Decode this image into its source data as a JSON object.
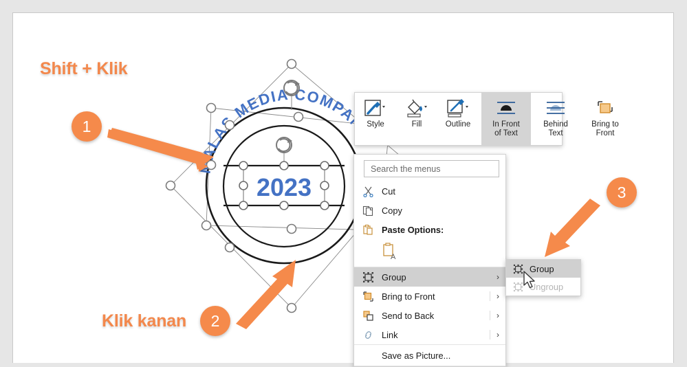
{
  "app": {
    "canvas_background": "#e6e6e6",
    "page_background": "#ffffff",
    "accent_orange": "#F58A4B",
    "wordart_blue": "#4472C4"
  },
  "artwork": {
    "wordart_curved_text": "MALAS MEDIA COMPANY",
    "year_text": "2023"
  },
  "annotations": {
    "labels": [
      {
        "id": "shift-klik",
        "text": "Shift + Klik",
        "color": "#F3884C"
      },
      {
        "id": "klik-kanan",
        "text": "Klik kanan",
        "color": "#F3884C"
      }
    ],
    "badges": [
      {
        "id": "badge-1",
        "number": "1"
      },
      {
        "id": "badge-2",
        "number": "2"
      },
      {
        "id": "badge-3",
        "number": "3"
      }
    ]
  },
  "mini_toolbar": {
    "buttons": [
      {
        "name": "style",
        "label": "Style",
        "icon": "style-brush-icon",
        "has_dropdown": true,
        "selected": false
      },
      {
        "name": "fill",
        "label": "Fill",
        "icon": "fill-bucket-icon",
        "has_dropdown": true,
        "selected": false
      },
      {
        "name": "outline",
        "label": "Outline",
        "icon": "outline-pen-icon",
        "has_dropdown": true,
        "selected": false
      },
      {
        "name": "in-front-of-text",
        "label": "In Front\nof Text",
        "icon": "in-front-of-text-icon",
        "has_dropdown": false,
        "selected": true
      },
      {
        "name": "behind-text",
        "label": "Behind\nText",
        "icon": "behind-text-icon",
        "has_dropdown": false,
        "selected": false
      },
      {
        "name": "bring-to-front",
        "label": "Bring to\nFront",
        "icon": "bring-to-front-icon",
        "has_dropdown": false,
        "selected": false
      }
    ]
  },
  "context_menu": {
    "search_placeholder": "Search the menus",
    "items": [
      {
        "name": "cut",
        "label": "Cut",
        "icon": "scissors-icon",
        "submenu": false,
        "highlighted": false
      },
      {
        "name": "copy",
        "label": "Copy",
        "icon": "copy-icon",
        "submenu": false,
        "highlighted": false
      },
      {
        "name": "paste-options",
        "label": "Paste Options:",
        "icon": "clipboard-icon",
        "submenu": false,
        "highlighted": false,
        "bold": true
      },
      {
        "name": "paste-keep-text-only",
        "label": "",
        "icon": "paste-text-only-icon",
        "submenu": false,
        "highlighted": false
      },
      {
        "name": "group",
        "label": "Group",
        "icon": "group-icon",
        "submenu": true,
        "highlighted": true
      },
      {
        "name": "bring-to-front",
        "label": "Bring to Front",
        "icon": "bring-to-front-icon",
        "submenu": true,
        "highlighted": false
      },
      {
        "name": "send-to-back",
        "label": "Send to Back",
        "icon": "send-to-back-icon",
        "submenu": true,
        "highlighted": false
      },
      {
        "name": "link",
        "label": "Link",
        "icon": "link-icon",
        "submenu": true,
        "highlighted": false
      },
      {
        "name": "save-as-picture",
        "label": "Save as Picture...",
        "icon": "",
        "submenu": false,
        "highlighted": false
      }
    ]
  },
  "submenu": {
    "items": [
      {
        "name": "group",
        "label": "Group",
        "icon": "group-icon",
        "highlighted": true,
        "disabled": false
      },
      {
        "name": "ungroup",
        "label": "Ungroup",
        "icon": "ungroup-icon",
        "highlighted": false,
        "disabled": true
      }
    ]
  }
}
